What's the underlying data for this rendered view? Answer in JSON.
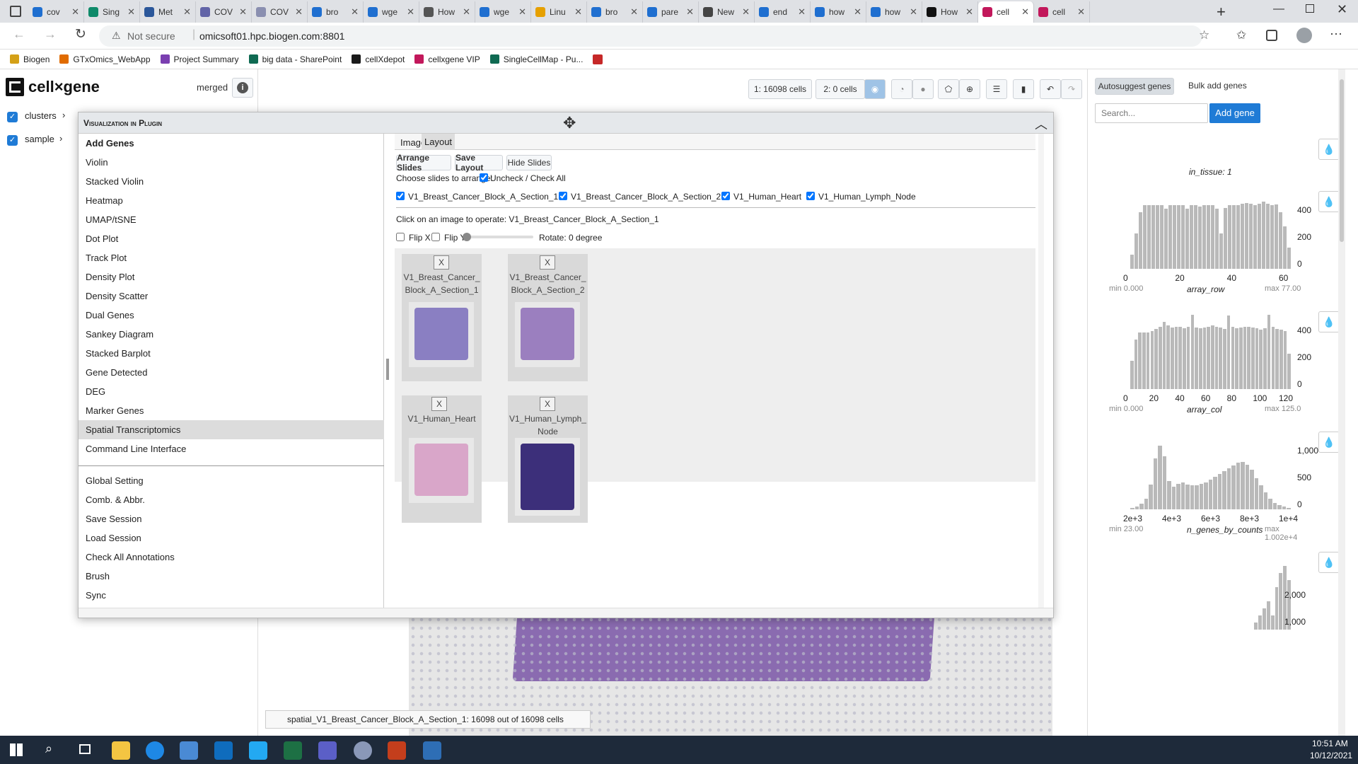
{
  "browser": {
    "tabs": [
      {
        "label": "cov",
        "color": "#1f6fd0"
      },
      {
        "label": "Sing",
        "color": "#0f8a6a"
      },
      {
        "label": "Met",
        "color": "#2b579a"
      },
      {
        "label": "COV",
        "color": "#6264a7"
      },
      {
        "label": "COV",
        "color": "#8a8fb0"
      },
      {
        "label": "bro",
        "color": "#1f6fd0"
      },
      {
        "label": "wge",
        "color": "#1f6fd0"
      },
      {
        "label": "How",
        "color": "#555555"
      },
      {
        "label": "wge",
        "color": "#1f6fd0"
      },
      {
        "label": "Linu",
        "color": "#e6a000"
      },
      {
        "label": "bro",
        "color": "#1f6fd0"
      },
      {
        "label": "pare",
        "color": "#1f6fd0"
      },
      {
        "label": "New",
        "color": "#444444"
      },
      {
        "label": "end",
        "color": "#1f6fd0"
      },
      {
        "label": "how",
        "color": "#1f6fd0"
      },
      {
        "label": "how",
        "color": "#1f6fd0"
      },
      {
        "label": "How",
        "color": "#111111"
      },
      {
        "label": "cell",
        "color": "#c2185b"
      },
      {
        "label": "cell",
        "color": "#c2185b"
      }
    ],
    "address": {
      "security": "Not secure",
      "url": "omicsoft01.hpc.biogen.com:8801"
    },
    "bookmarks": [
      "Biogen",
      "GTxOmics_WebApp",
      "Project Summary",
      "big data - SharePoint",
      "cellXdepot",
      "cellxgene VIP",
      "SingleCellMap - Pu..."
    ]
  },
  "app": {
    "logo": "cell×gene",
    "dataset": "merged",
    "categories": [
      {
        "label": "clusters"
      },
      {
        "label": "sample"
      }
    ],
    "toolbar": {
      "set1": "1: 16098 cells",
      "set2": "2: 0 cells"
    },
    "right": {
      "autosuggest": "Autosuggest genes",
      "bulk": "Bulk add genes",
      "search_placeholder": "Search...",
      "add_gene": "Add gene",
      "in_tissue": "in_tissue: 1"
    },
    "status": "spatial_V1_Breast_Cancer_Block_A_Section_1: 16098 out of 16098 cells"
  },
  "modal": {
    "title": "Visualization in Plugin",
    "menu": [
      "Add Genes",
      "Violin",
      "Stacked Violin",
      "Heatmap",
      "UMAP/tSNE",
      "Dot Plot",
      "Track Plot",
      "Density Plot",
      "Density Scatter",
      "Dual Genes",
      "Sankey Diagram",
      "Stacked Barplot",
      "Gene Detected",
      "DEG",
      "Marker Genes",
      "Spatial Transcriptomics",
      "Command Line Interface"
    ],
    "menu2": [
      "Global Setting",
      "Comb. & Abbr.",
      "Save Session",
      "Load Session",
      "Check All Annotations",
      "Brush",
      "Sync"
    ],
    "tabs": [
      "Image",
      "Layout"
    ],
    "buttons": {
      "arrange": "Arrange Slides",
      "save": "Save Layout",
      "hide": "Hide Slides"
    },
    "choose_label": "Choose slides to arrange:",
    "check_all": "Uncheck / Check All",
    "slides": [
      "V1_Breast_Cancer_Block_A_Section_1",
      "V1_Breast_Cancer_Block_A_Section_2",
      "V1_Human_Heart",
      "V1_Human_Lymph_Node"
    ],
    "operate_prefix": "Click on an image to operate: V1_Breast_Cancer_Block_A_Section_1",
    "flipx": "Flip X",
    "flipy": "Flip Y",
    "rotate": "Rotate: 0 degree",
    "cards": [
      {
        "name1": "V1_Breast_Cancer_",
        "name2": "Block_A_Section_1",
        "x": "X"
      },
      {
        "name1": "V1_Breast_Cancer_",
        "name2": "Block_A_Section_2",
        "x": "X"
      },
      {
        "name1": "V1_Human_Heart",
        "name2": "",
        "x": "X"
      },
      {
        "name1": "V1_Human_Lymph_",
        "name2": "Node",
        "x": "X"
      }
    ]
  },
  "histograms": [
    {
      "field": "array_row",
      "min": "min 0.000",
      "max": "max 77.00",
      "xticks": [
        "0",
        "20",
        "40",
        "60"
      ],
      "yticks": [
        "400",
        "200",
        "0"
      ]
    },
    {
      "field": "array_col",
      "min": "min 0.000",
      "max": "max 125.0",
      "xticks": [
        "0",
        "20",
        "40",
        "60",
        "80",
        "100",
        "120"
      ],
      "yticks": [
        "400",
        "200",
        "0"
      ]
    },
    {
      "field": "n_genes_by_counts",
      "min": "min 23.00",
      "max": "max 1.002e+4",
      "xticks": [
        "2e+3",
        "4e+3",
        "6e+3",
        "8e+3",
        "1e+4"
      ],
      "yticks": [
        "1,000",
        "500",
        "0"
      ]
    },
    {
      "field": "",
      "min": "",
      "max": "",
      "xticks": [],
      "yticks": [
        "2,000",
        "1,000"
      ]
    }
  ],
  "taskbar": {
    "time": "10:51 AM",
    "date": "10/12/2021"
  }
}
